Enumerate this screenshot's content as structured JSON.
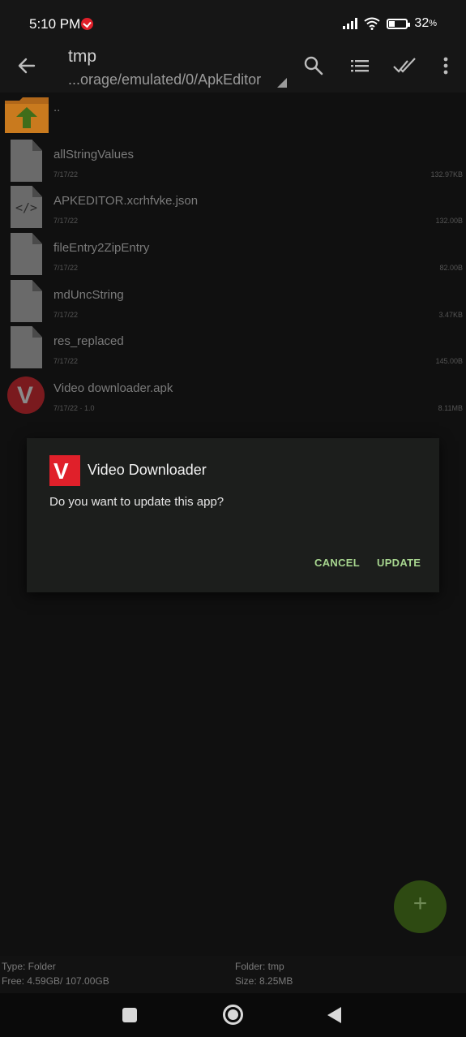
{
  "status_bar": {
    "time": "5:10 PM",
    "battery": "32"
  },
  "app_bar": {
    "title": "tmp",
    "path": "...orage/emulated/0/ApkEditor"
  },
  "files": [
    {
      "name": "..",
      "date": "",
      "size": "",
      "icon": "folder-up-icon"
    },
    {
      "name": "allStringValues",
      "date": "7/17/22",
      "size": "132.97KB",
      "icon": "file-icon"
    },
    {
      "name": "APKEDITOR.xcrhfvke.json",
      "date": "7/17/22",
      "size": "132.00B",
      "icon": "code-file-icon"
    },
    {
      "name": "fileEntry2ZipEntry",
      "date": "7/17/22",
      "size": "82.00B",
      "icon": "file-icon"
    },
    {
      "name": "mdUncString",
      "date": "7/17/22",
      "size": "3.47KB",
      "icon": "file-icon"
    },
    {
      "name": "res_replaced",
      "date": "7/17/22",
      "size": "145.00B",
      "icon": "file-icon"
    },
    {
      "name": "Video downloader.apk",
      "date": "7/17/22  ·  1.0",
      "size": "8.11MB",
      "icon": "app-icon"
    }
  ],
  "dialog": {
    "title": "Video Downloader",
    "message": "Do you want to update this app?",
    "cancel_label": "CANCEL",
    "update_label": "UPDATE",
    "icon_letter": "V"
  },
  "fab": {
    "label": "+"
  },
  "footer": {
    "type": "Type: Folder",
    "free": "Free: 4.59GB/ 107.00GB",
    "folder": "Folder: tmp",
    "size": "Size: 8.25MB"
  },
  "colors": {
    "accent": "#a7d68f",
    "brand_red": "#e0202a",
    "fab": "#2e4a12"
  }
}
